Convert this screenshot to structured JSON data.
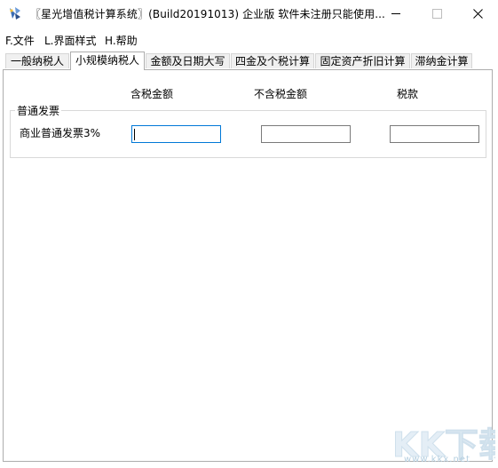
{
  "window": {
    "title": "〖星光增值税计算系统〗(Build20191013) 企业版 软件未注册只能使用..."
  },
  "menu": [
    "F.文件",
    "L.界面样式",
    "H.帮助"
  ],
  "tabs": [
    {
      "label": "一般纳税人",
      "active": false
    },
    {
      "label": "小规模纳税人",
      "active": true
    },
    {
      "label": "金额及日期大写",
      "active": false
    },
    {
      "label": "四金及个税计算",
      "active": false
    },
    {
      "label": "固定资产折旧计算",
      "active": false
    },
    {
      "label": "滞纳金计算",
      "active": false
    }
  ],
  "panel": {
    "columns": [
      "含税金额",
      "不含税金额",
      "税款"
    ],
    "group_title": "普通发票",
    "row_label": "商业普通发票3%",
    "inputs": {
      "tax_inclusive": "",
      "tax_exclusive": "",
      "tax": ""
    }
  },
  "watermark": {
    "logo": "KK下载",
    "site": "www.kkx.net"
  },
  "icons": {
    "app": "app-logo-icon",
    "minimize": "minimize-icon",
    "maximize": "maximize-icon",
    "close": "close-icon"
  }
}
